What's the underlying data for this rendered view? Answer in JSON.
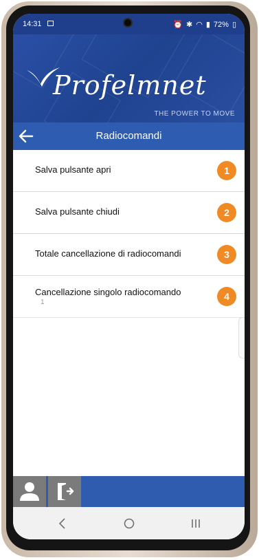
{
  "status_bar": {
    "time": "14:31",
    "battery": "72%"
  },
  "header": {
    "logo_text": "Profelmnet",
    "tagline": "THE POWER TO MOVE"
  },
  "titlebar": {
    "title": "Radiocomandi"
  },
  "menu": {
    "items": [
      {
        "label": "Salva pulsante apri",
        "badge": "1"
      },
      {
        "label": "Salva pulsante chiudi",
        "badge": "2"
      },
      {
        "label": "Totale cancellazione di radiocomandi",
        "badge": "3"
      },
      {
        "label": "Cancellazione singolo radiocomando",
        "sub": "1",
        "badge": "4"
      }
    ]
  },
  "colors": {
    "primary": "#2d5cb0",
    "header": "#1f438f",
    "badge": "#ef8a25",
    "bottom_buttons": "#7b7b7b"
  },
  "icons": {
    "back": "arrow-left-icon",
    "user": "user-icon",
    "exit": "logout-icon",
    "nav": [
      "nav-back-icon",
      "nav-home-icon",
      "nav-recent-icon"
    ]
  }
}
